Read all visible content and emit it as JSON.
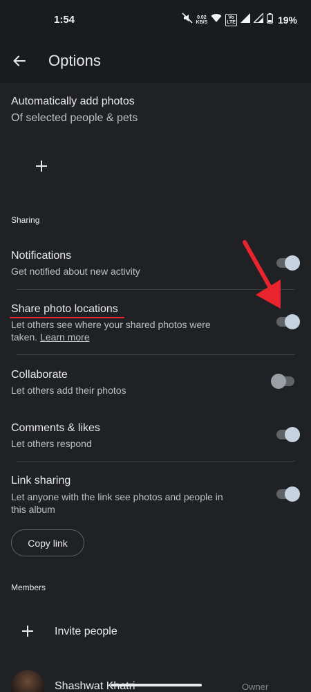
{
  "status_bar": {
    "time": "1:54",
    "net_speed_top": "0.02",
    "net_speed_bottom": "KB/S",
    "volte_top": "Vo",
    "volte_bottom": "LTE",
    "battery_pct": "19%"
  },
  "app_bar": {
    "title": "Options"
  },
  "auto_add": {
    "title": "Automatically add photos",
    "subtitle": "Of selected people & pets"
  },
  "sharing": {
    "section_label": "Sharing",
    "notifications": {
      "title": "Notifications",
      "subtitle": "Get notified about new activity",
      "enabled": true
    },
    "share_locations": {
      "title": "Share photo locations",
      "subtitle_line1": "Let others see where your shared photos were",
      "subtitle_line2": "taken.",
      "learn_more": "Learn more",
      "enabled": true
    },
    "collaborate": {
      "title": "Collaborate",
      "subtitle": "Let others add their photos",
      "enabled": false
    },
    "comments": {
      "title": "Comments & likes",
      "subtitle": "Let others respond",
      "enabled": true
    },
    "link_sharing": {
      "title": "Link sharing",
      "subtitle_line1": "Let anyone with the link see photos and people in",
      "subtitle_line2": "this album",
      "enabled": true
    },
    "copy_link_label": "Copy link"
  },
  "members": {
    "section_label": "Members",
    "invite_label": "Invite people",
    "list": [
      {
        "name": "Shashwat Khatri",
        "role": "Owner"
      }
    ]
  },
  "colors": {
    "background": "#202124",
    "toolbar": "#1a1b1e",
    "annotation_red": "#e8252d",
    "toggle_thumb_on": "#c5d3e0"
  }
}
